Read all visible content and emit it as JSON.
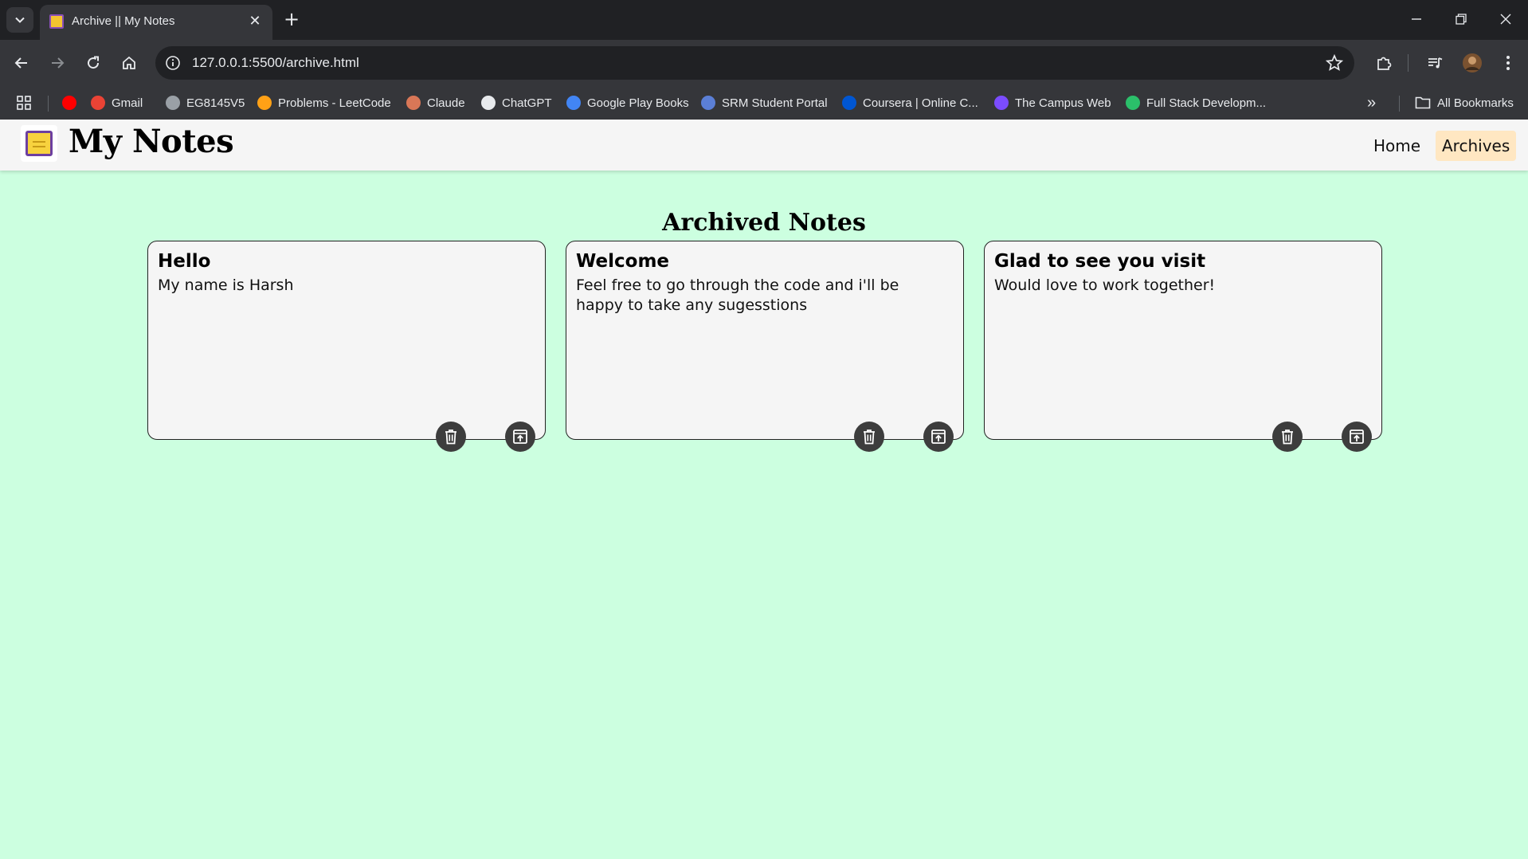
{
  "browser": {
    "tab_title": "Archive || My Notes",
    "tab_close": "✕",
    "new_tab": "+",
    "url": "127.0.0.1:5500/archive.html",
    "bookmarks": [
      {
        "label": "",
        "icon": "youtube-icon",
        "color": "#ff0000"
      },
      {
        "label": "Gmail",
        "icon": "gmail-icon",
        "color": "#ea4335"
      },
      {
        "label": "EG8145V5",
        "icon": "globe-icon",
        "color": "#9aa0a6"
      },
      {
        "label": "Problems - LeetCode",
        "icon": "leetcode-icon",
        "color": "#ffa116"
      },
      {
        "label": "Claude",
        "icon": "claude-icon",
        "color": "#d97757"
      },
      {
        "label": "ChatGPT",
        "icon": "chatgpt-icon",
        "color": "#e8eaed"
      },
      {
        "label": "Google Play Books",
        "icon": "play-books-icon",
        "color": "#4285f4"
      },
      {
        "label": "SRM Student Portal",
        "icon": "srm-icon",
        "color": "#5b7fd6"
      },
      {
        "label": "Coursera | Online C...",
        "icon": "coursera-icon",
        "color": "#0056d2"
      },
      {
        "label": "The Campus Web",
        "icon": "campus-web-icon",
        "color": "#7b4cff"
      },
      {
        "label": "Full Stack Developm...",
        "icon": "fullstack-icon",
        "color": "#2bbf6a"
      }
    ],
    "more_bookmarks": "»",
    "all_bookmarks": "All Bookmarks"
  },
  "app": {
    "brand": "My Notes",
    "nav": {
      "home": "Home",
      "archives": "Archives"
    },
    "heading": "Archived Notes",
    "notes": [
      {
        "title": "Hello",
        "body": "My name is Harsh"
      },
      {
        "title": "Welcome",
        "body": "Feel free to go through the code and i'll be happy to take any sugesstions"
      },
      {
        "title": "Glad to see you visit",
        "body": "Would love to work together!"
      }
    ]
  },
  "colors": {
    "page_background": "#ccffe0",
    "navbar": "#f5f5f5",
    "active_nav": "#ffe7c2",
    "card": "#f5f5f5",
    "action_button": "#3d3d3d"
  }
}
